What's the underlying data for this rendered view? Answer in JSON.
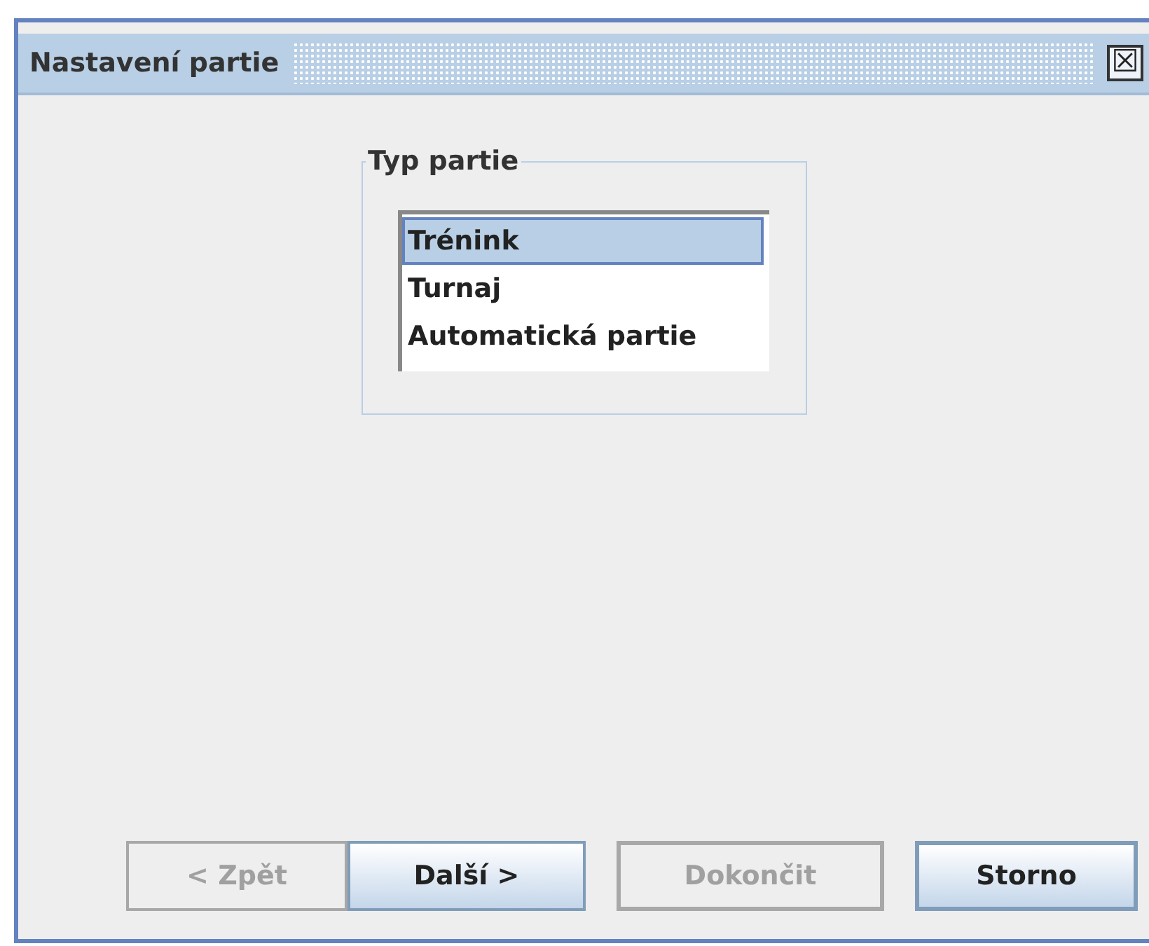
{
  "window": {
    "title": "Nastavení partie",
    "close_label": "☒"
  },
  "group": {
    "title": "Typ partie",
    "items": [
      {
        "label": "Trénink",
        "selected": true
      },
      {
        "label": "Turnaj",
        "selected": false
      },
      {
        "label": "Automatická partie",
        "selected": false
      }
    ]
  },
  "buttons": [
    {
      "label": "< Zpět",
      "disabled": true,
      "kind": "joined"
    },
    {
      "label": "Další >",
      "disabled": false,
      "kind": "joined"
    },
    {
      "label": "Dokončit",
      "disabled": true,
      "kind": "single"
    },
    {
      "label": "Storno",
      "disabled": false,
      "kind": "single"
    }
  ]
}
